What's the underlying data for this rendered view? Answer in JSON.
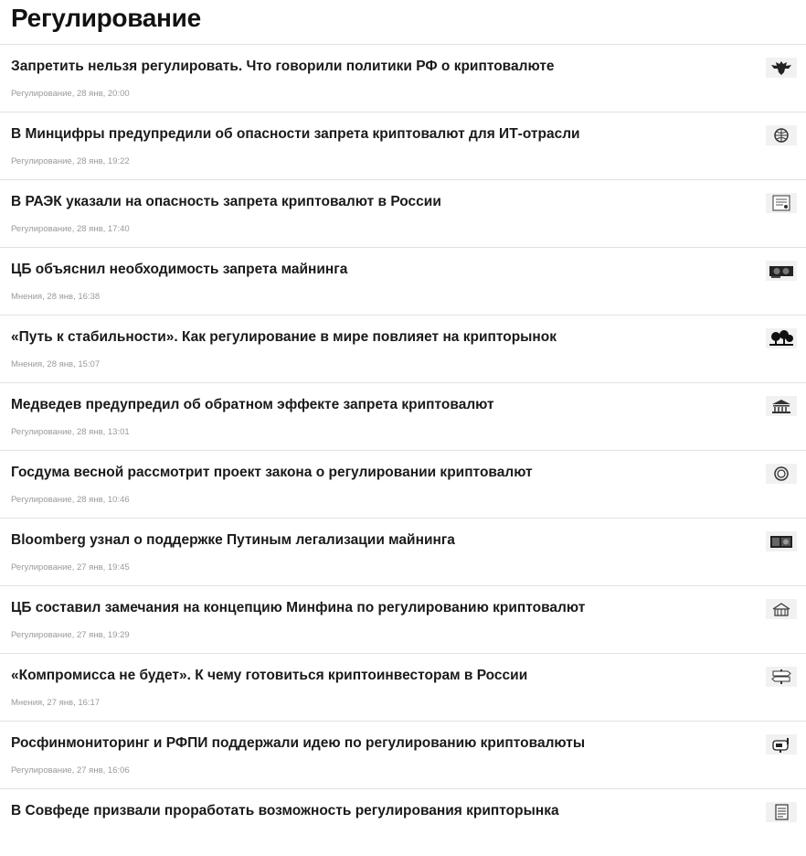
{
  "page": {
    "title": "Регулирование"
  },
  "articles": [
    {
      "title": "Запретить нельзя регулировать. Что говорили политики РФ о криптовалюте",
      "category": "Регулирование",
      "date": "28 янв, 20:00",
      "thumb_icon": "eagle-emblem-icon"
    },
    {
      "title": "В Минцифры предупредили об опасности запрета криптовалют для ИТ-отрасли",
      "category": "Регулирование",
      "date": "28 янв, 19:22",
      "thumb_icon": "globe-icon"
    },
    {
      "title": "В РАЭК указали на опасность запрета криптовалют в России",
      "category": "Регулирование",
      "date": "28 янв, 17:40",
      "thumb_icon": "document-icon"
    },
    {
      "title": "ЦБ объяснил необходимость запрета майнинга",
      "category": "Мнения",
      "date": "28 янв, 16:38",
      "thumb_icon": "graphics-card-icon"
    },
    {
      "title": "«Путь к стабильности». Как регулирование в мире повлияет на крипторынок",
      "category": "Мнения",
      "date": "28 янв, 15:07",
      "thumb_icon": "trees-icon"
    },
    {
      "title": "Медведев предупредил об обратном эффекте запрета криптовалют",
      "category": "Регулирование",
      "date": "28 янв, 13:01",
      "thumb_icon": "bank-building-icon"
    },
    {
      "title": "Госдума весной рассмотрит проект закона о регулировании криптовалют",
      "category": "Регулирование",
      "date": "28 янв, 10:46",
      "thumb_icon": "coin-icon"
    },
    {
      "title": "Bloomberg узнал о поддержке Путиным легализации майнинга",
      "category": "Регулирование",
      "date": "27 янв, 19:45",
      "thumb_icon": "mining-rig-icon"
    },
    {
      "title": "ЦБ составил замечания на концепцию Минфина по регулированию криптовалют",
      "category": "Регулирование",
      "date": "27 янв, 19:29",
      "thumb_icon": "building-icon"
    },
    {
      "title": "«Компромисса не будет». К чему готовиться криптоинвесторам в России",
      "category": "Мнения",
      "date": "27 янв, 16:17",
      "thumb_icon": "signpost-icon"
    },
    {
      "title": "Росфинмониторинг и РФПИ поддержали идею по регулированию криптовалюты",
      "category": "Регулирование",
      "date": "27 янв, 16:06",
      "thumb_icon": "mailbox-icon"
    },
    {
      "title": "В Совфеде призвали проработать возможность регулирования крипторынка",
      "category": "",
      "date": "",
      "thumb_icon": "paper-icon"
    }
  ]
}
